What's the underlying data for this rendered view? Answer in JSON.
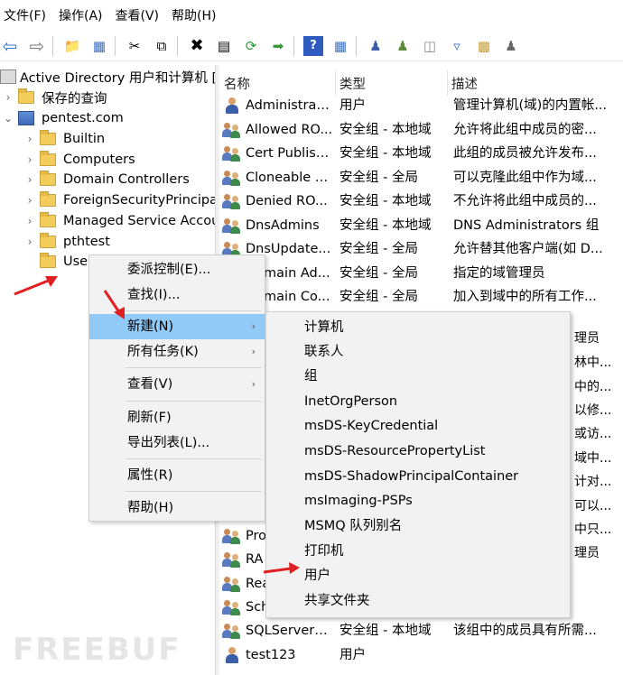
{
  "menubar": {
    "items": [
      "文件(F)",
      "操作(A)",
      "查看(V)",
      "帮助(H)"
    ]
  },
  "toolbar": {
    "icons": [
      "back-icon",
      "forward-icon",
      "up-folder-icon",
      "console-tree-icon",
      "cut-icon",
      "copy-icon",
      "delete-icon",
      "properties-icon",
      "refresh-icon",
      "export-icon",
      "help-icon",
      "view-icon",
      "new-user-icon",
      "new-group-icon",
      "new-ou-icon",
      "filter-icon",
      "find-icon",
      "delegate-icon"
    ]
  },
  "tree": {
    "root": "Active Directory 用户和计算机 [",
    "saved_queries": "保存的查询",
    "domain": "pentest.com",
    "children": [
      "Builtin",
      "Computers",
      "Domain Controllers",
      "ForeignSecurityPrincipal",
      "Managed Service Accou",
      "pthtest",
      "Use"
    ]
  },
  "list": {
    "headers": {
      "name": "名称",
      "type": "类型",
      "desc": "描述"
    },
    "rows_top": [
      {
        "icon": "user",
        "name": "Administrator",
        "type": "用户",
        "desc": "管理计算机(域)的内置帐..."
      },
      {
        "icon": "group",
        "name": "Allowed RO...",
        "type": "安全组 - 本地域",
        "desc": "允许将此组中成员的密..."
      },
      {
        "icon": "group",
        "name": "Cert Publish...",
        "type": "安全组 - 本地域",
        "desc": "此组的成员被允许发布..."
      },
      {
        "icon": "group",
        "name": "Cloneable D...",
        "type": "安全组 - 全局",
        "desc": "可以克隆此组中作为域..."
      },
      {
        "icon": "group",
        "name": "Denied RO...",
        "type": "安全组 - 本地域",
        "desc": "不允许将此组中成员的..."
      },
      {
        "icon": "group",
        "name": "DnsAdmins",
        "type": "安全组 - 本地域",
        "desc": "DNS Administrators 组"
      },
      {
        "icon": "group",
        "name": "DnsUpdate...",
        "type": "安全组 - 全局",
        "desc": "允许替其他客户端(如 D..."
      },
      {
        "icon": "group",
        "name": "Domain Ad...",
        "type": "安全组 - 全局",
        "desc": "指定的域管理员"
      },
      {
        "icon": "group",
        "name": "Domain Co...",
        "type": "安全组 - 全局",
        "desc": "加入到域中的所有工作..."
      }
    ],
    "rows_right_fragments": [
      "理员",
      "林中...",
      "中的...",
      "以修...",
      "或访...",
      "域中...",
      "计对...",
      "可以...",
      "中只...",
      "理员"
    ],
    "rows_partial": [
      {
        "icon": "group",
        "name": "Pro"
      },
      {
        "icon": "group",
        "name": "RA"
      },
      {
        "icon": "group",
        "name": "Rea"
      },
      {
        "icon": "group",
        "name": "Sch"
      }
    ],
    "rows_bottom": [
      {
        "icon": "group",
        "name": "SQLServer2...",
        "type": "安全组 - 本地域",
        "desc": "该组中的成员具有所需..."
      },
      {
        "icon": "user",
        "name": "test123",
        "type": "用户",
        "desc": ""
      }
    ]
  },
  "context_menu": {
    "items": [
      {
        "label": "委派控制(E)...",
        "submenu": false,
        "highlighted": false
      },
      {
        "label": "查找(I)...",
        "submenu": false,
        "highlighted": false
      },
      {
        "label": "新建(N)",
        "submenu": true,
        "highlighted": true
      },
      {
        "label": "所有任务(K)",
        "submenu": true,
        "highlighted": false
      },
      {
        "label": "查看(V)",
        "submenu": true,
        "highlighted": false
      },
      {
        "label": "刷新(F)",
        "submenu": false,
        "highlighted": false
      },
      {
        "label": "导出列表(L)...",
        "submenu": false,
        "highlighted": false
      },
      {
        "label": "属性(R)",
        "submenu": false,
        "highlighted": false
      },
      {
        "label": "帮助(H)",
        "submenu": false,
        "highlighted": false
      }
    ]
  },
  "new_submenu": {
    "items": [
      "计算机",
      "联系人",
      "组",
      "InetOrgPerson",
      "msDS-KeyCredential",
      "msDS-ResourcePropertyList",
      "msDS-ShadowPrincipalContainer",
      "msImaging-PSPs",
      "MSMQ 队列别名",
      "打印机",
      "用户",
      "共享文件夹"
    ]
  },
  "watermark": "FREEBUF",
  "colors": {
    "highlight": "#91c9f7",
    "menu_bg": "#f2f2f2",
    "arrow_red": "#e02020"
  }
}
